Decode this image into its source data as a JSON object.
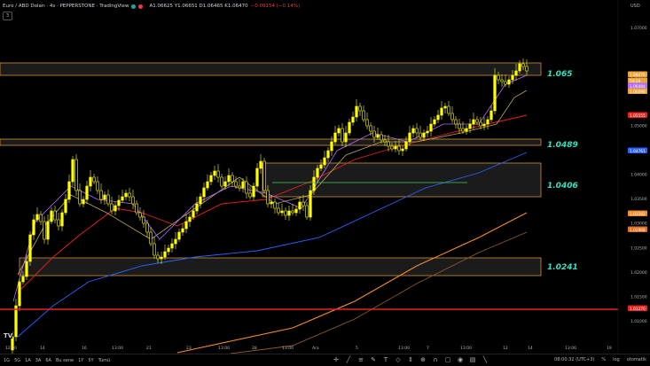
{
  "header": {
    "title": "Euro / ABD Doları · 4s · PEPPERSTONE · TradingView",
    "ohlc": "A1.06625 Y1.06651 D1.06465 K1.06470",
    "change": "−0.00154 (−0.14%)",
    "collapse_label": "3"
  },
  "price_axis": {
    "currency": "USD",
    "ticks": [
      "1.07000",
      "1.06000",
      "1.05000",
      "1.04500",
      "1.04000",
      "1.03500",
      "1.03000",
      "1.02500",
      "1.02000",
      "1.01500",
      "1.01000"
    ],
    "badges": [
      {
        "label": "1.06470",
        "color": "#eda33b"
      },
      {
        "label": "59:26",
        "color": "#eda33b"
      },
      {
        "label": "1.06484",
        "color": "#b36bff"
      },
      {
        "label": "1.06096",
        "color": "#eda33b"
      },
      {
        "label": "1.05555",
        "color": "#e8221e"
      },
      {
        "label": "1.04761",
        "color": "#2962ff"
      },
      {
        "label": "1.03392",
        "color": "#f28c28"
      },
      {
        "label": "1.02968",
        "color": "#e07020"
      },
      {
        "label": "1.01270",
        "color": "#e8221e"
      }
    ]
  },
  "time_axis": {
    "labels": [
      "12:00",
      "14",
      "16",
      "13:00",
      "21",
      "23",
      "13:00",
      "28",
      "13:00",
      "Ara",
      "5",
      "13:00",
      "7",
      "13:00",
      "12",
      "14",
      "13:00",
      "19",
      "21"
    ]
  },
  "levels": [
    {
      "label": "1.065"
    },
    {
      "label": "1.0489"
    },
    {
      "label": "1.0406"
    },
    {
      "label": "1.0241"
    }
  ],
  "bottom_bar": {
    "timeframes": [
      "1G",
      "5G",
      "1A",
      "3A",
      "6A",
      "Bu sene",
      "1Y",
      "5Y",
      "Tümü"
    ],
    "clock": "08:00:32 (UTC+3)",
    "pct": "%",
    "log": "log",
    "auto": "otomatik"
  },
  "colors": {
    "candle": "#ffff00",
    "ma_fast": "#b36bff",
    "ma_mid": "#b8a85a",
    "ma_red": "#e8221e",
    "ma_blue": "#2962ff",
    "ma_orange": "#f28c28",
    "zone_border": "#eda33b",
    "level_text": "#37e0c2"
  }
}
